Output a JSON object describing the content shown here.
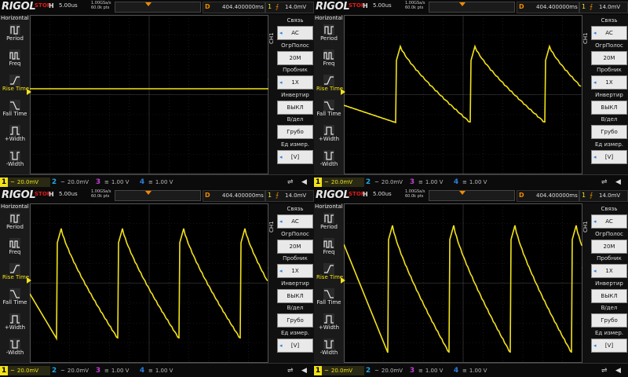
{
  "panels": [
    {
      "brand": "RIGOL",
      "status": "STOP",
      "h_label": "H",
      "timebase": "5.00us",
      "sample_rate": "1.00GSa/s",
      "memory_depth": "60.0k pts",
      "d_label": "D",
      "delay": "404.400000ms",
      "trig_source": "1",
      "trig_level": "14.0mV",
      "sidebar_title": "Horizontal",
      "ch_tab": "CH1",
      "waveform": "flat"
    },
    {
      "brand": "RIGOL",
      "status": "STOP",
      "h_label": "H",
      "timebase": "5.00us",
      "sample_rate": "1.00GSa/s",
      "memory_depth": "60.0k pts",
      "d_label": "D",
      "delay": "404.400000ms",
      "trig_source": "1",
      "trig_level": "14.0mV",
      "sidebar_title": "Horizontal",
      "ch_tab": "CH1",
      "waveform": "saw-decay"
    },
    {
      "brand": "RIGOL",
      "status": "STOP",
      "h_label": "H",
      "timebase": "5.00us",
      "sample_rate": "1.00GSa/s",
      "memory_depth": "60.0k pts",
      "d_label": "D",
      "delay": "404.400000ms",
      "trig_source": "1",
      "trig_level": "14.0mV",
      "sidebar_title": "Horizontal",
      "ch_tab": "CH1",
      "waveform": "saw-4"
    },
    {
      "brand": "RIGOL",
      "status": "STOP",
      "h_label": "H",
      "timebase": "5.00us",
      "sample_rate": "1.00GSa/s",
      "memory_depth": "60.0k pts",
      "d_label": "D",
      "delay": "404.400000ms",
      "trig_source": "1",
      "trig_level": "14.0mV",
      "sidebar_title": "Horizontal",
      "ch_tab": "CH1",
      "waveform": "saw-ramp"
    }
  ],
  "sidebar": {
    "items": [
      {
        "label": "Period",
        "icon": "period-icon"
      },
      {
        "label": "Freq",
        "icon": "frequency-icon"
      },
      {
        "label": "Rise Time",
        "icon": "rise-time-icon"
      },
      {
        "label": "Fall Time",
        "icon": "fall-time-icon"
      },
      {
        "label": "+Width",
        "icon": "positive-width-icon"
      },
      {
        "label": "-Width",
        "icon": "negative-width-icon"
      }
    ]
  },
  "menu": {
    "items": [
      {
        "title": "Связь",
        "value": "AC",
        "has_arrow": true
      },
      {
        "title": "ОгрПолос",
        "value": "20M",
        "has_arrow": false
      },
      {
        "title": "Пробник",
        "value": "1X",
        "has_arrow": true
      },
      {
        "title": "Инвертир",
        "value": "ВЫКЛ",
        "has_arrow": false
      },
      {
        "title": "В/дел",
        "value": "Грубо",
        "has_arrow": false
      },
      {
        "title": "Ед измер.",
        "value": "[V]",
        "has_arrow": true
      }
    ]
  },
  "channels": [
    {
      "num": "1",
      "value": "20.0mV",
      "coupling": "~"
    },
    {
      "num": "2",
      "value": "20.0mV",
      "coupling": "~"
    },
    {
      "num": "3",
      "value": "1.00 V",
      "coupling": "≡"
    },
    {
      "num": "4",
      "value": "1.00 V",
      "coupling": "≡"
    }
  ],
  "colors": {
    "ch1": "#f2e21a",
    "ch2": "#1fa6e0",
    "ch3": "#c040d0",
    "ch4": "#2b7de0",
    "accent": "#f08a00",
    "stop": "#e01818"
  },
  "status_icons": {
    "usb": "usb-icon",
    "speaker": "speaker-icon"
  }
}
